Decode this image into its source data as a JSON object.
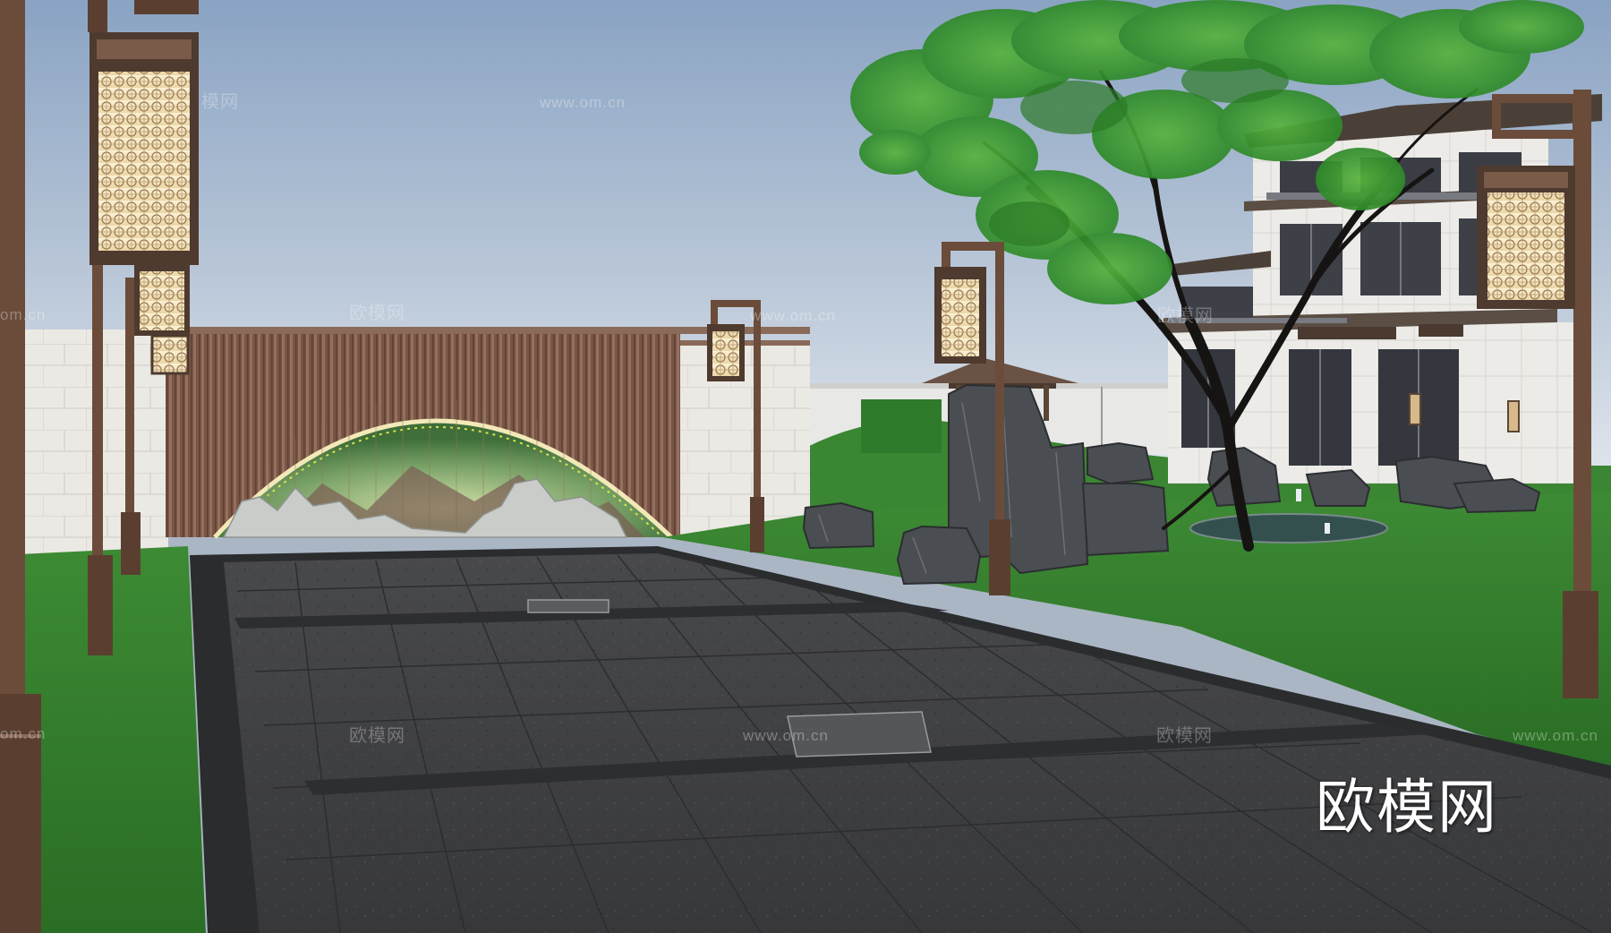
{
  "watermark": {
    "brand_text": "欧模网",
    "url_text": "www.om.cn",
    "cn_fragment": "模网",
    "om_fragment": "om.cn"
  },
  "colors": {
    "sky_top": "#8ea6c6",
    "sky_bottom": "#dfe6ee",
    "pavement": "#3e3f42",
    "lawn": "#2f7d2a",
    "bronze": "#6e4d3a",
    "wall_stone": "#e9e7e2",
    "arch_glow": "#f3e9b8"
  },
  "icons": [
    "lamp-post",
    "feature-wall-arch",
    "rock",
    "tree",
    "villa-building"
  ]
}
